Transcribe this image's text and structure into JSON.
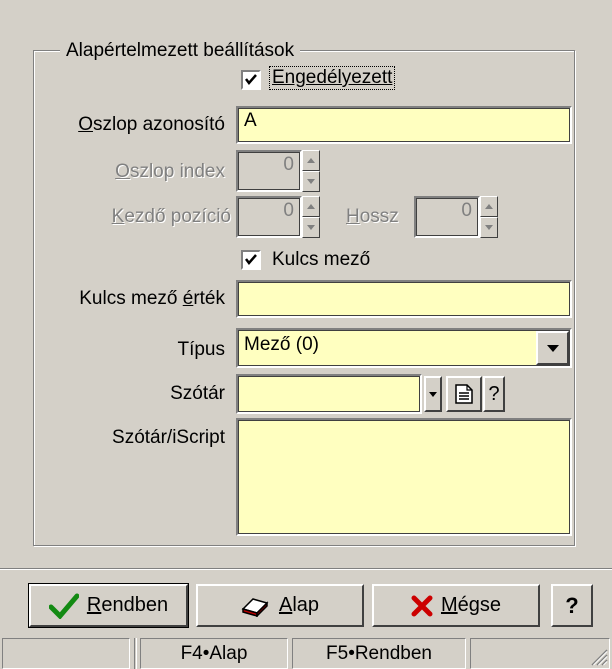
{
  "group": {
    "title": "Alapértelmezett beállítások"
  },
  "form": {
    "enabled": {
      "label": "Engedélyezett",
      "checked": true
    },
    "column_id": {
      "label_underlined": "O",
      "label_rest": "szlop azonosító",
      "value": "A"
    },
    "column_index": {
      "label_underlined": "O",
      "label_rest": "szlop index",
      "value": "0"
    },
    "start_pos": {
      "label_underlined": "K",
      "label_rest": "ezdő pozíció",
      "value": "0"
    },
    "length": {
      "label_underlined": "H",
      "label_rest": "ossz",
      "value": "0"
    },
    "key_field": {
      "label": "Kulcs mező",
      "checked": true
    },
    "key_value": {
      "label_before": "Kulcs mező ",
      "label_underlined": "é",
      "label_after": "rték",
      "value": ""
    },
    "type": {
      "label": "Típus",
      "value": "Mező (0)"
    },
    "dictionary": {
      "label": "Szótár",
      "value": "",
      "help": "?"
    },
    "script": {
      "label": "Szótár/iScript",
      "value": ""
    }
  },
  "buttons": {
    "ok": {
      "underlined": "R",
      "rest": "endben"
    },
    "default": {
      "underlined": "A",
      "rest": "lap"
    },
    "cancel": {
      "underlined": "M",
      "rest": "égse"
    },
    "help": "?"
  },
  "statusbar": {
    "f4": "F4•Alap",
    "f5": "F5•Rendben"
  }
}
